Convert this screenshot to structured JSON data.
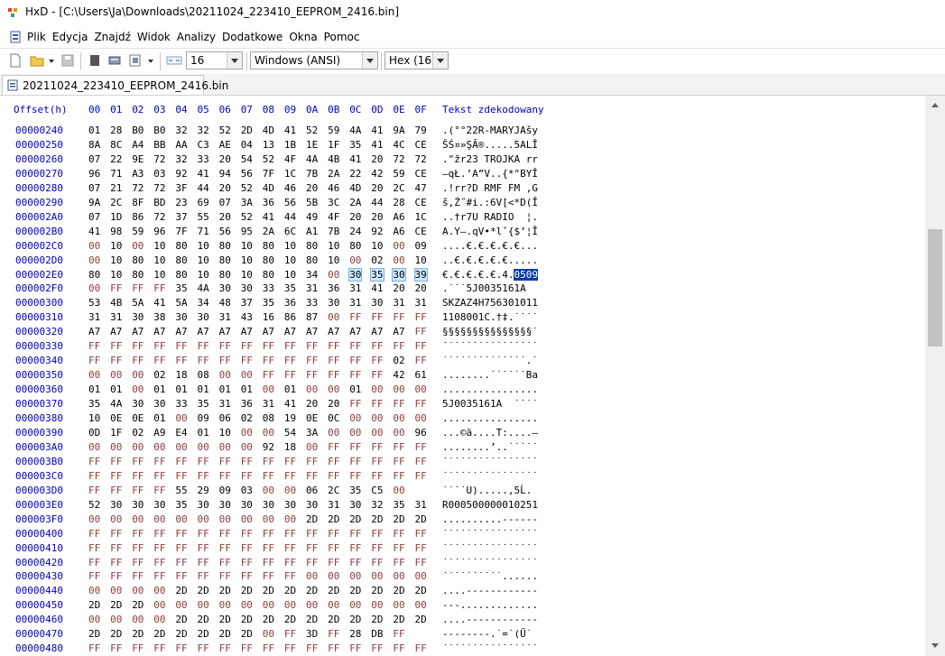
{
  "window": {
    "title": "HxD - [C:\\Users\\Ja\\Downloads\\20211024_223410_EEPROM_2416.bin]"
  },
  "menu": {
    "items": [
      "Plik",
      "Edycja",
      "Znajdź",
      "Widok",
      "Analizy",
      "Dodatkowe",
      "Okna",
      "Pomoc"
    ]
  },
  "toolbar": {
    "bytes_per_row": "16",
    "charset": "Windows (ANSI)",
    "number_base": "Hex (16)"
  },
  "tab": {
    "label": "20211024_223410_EEPROM_2416.bin"
  },
  "hex": {
    "offset_header": "Offset(h)",
    "column_headers": [
      "00",
      "01",
      "02",
      "03",
      "04",
      "05",
      "06",
      "07",
      "08",
      "09",
      "0A",
      "0B",
      "0C",
      "0D",
      "0E",
      "0F"
    ],
    "text_header": "Tekst zdekodowany",
    "rows": [
      {
        "offset": "00000240",
        "bytes": [
          "01",
          "28",
          "B0",
          "B0",
          "32",
          "32",
          "52",
          "2D",
          "4D",
          "41",
          "52",
          "59",
          "4A",
          "41",
          "9A",
          "79"
        ],
        "text": ".(°°22R-MARYJAšy"
      },
      {
        "offset": "00000250",
        "bytes": [
          "8A",
          "8C",
          "A4",
          "BB",
          "AA",
          "C3",
          "AE",
          "04",
          "13",
          "1B",
          "1E",
          "1F",
          "35",
          "41",
          "4C",
          "CE"
        ],
        "text": "ŠŚ¤»ŞĂ®.....5ALÎ"
      },
      {
        "offset": "00000260",
        "bytes": [
          "07",
          "22",
          "9E",
          "72",
          "32",
          "33",
          "20",
          "54",
          "52",
          "4F",
          "4A",
          "4B",
          "41",
          "20",
          "72",
          "72"
        ],
        "text": ".\"žr23 TROJKA rr"
      },
      {
        "offset": "00000270",
        "bytes": [
          "96",
          "71",
          "A3",
          "03",
          "92",
          "41",
          "94",
          "56",
          "7F",
          "1C",
          "7B",
          "2A",
          "22",
          "42",
          "59",
          "CE"
        ],
        "text": "–qŁ.’A”V..{*\"BYÎ"
      },
      {
        "offset": "00000280",
        "bytes": [
          "07",
          "21",
          "72",
          "72",
          "3F",
          "44",
          "20",
          "52",
          "4D",
          "46",
          "20",
          "46",
          "4D",
          "20",
          "2C",
          "47"
        ],
        "text": ".!rr?D RMF FM ,G"
      },
      {
        "offset": "00000290",
        "bytes": [
          "9A",
          "2C",
          "8F",
          "BD",
          "23",
          "69",
          "07",
          "3A",
          "36",
          "56",
          "5B",
          "3C",
          "2A",
          "44",
          "28",
          "CE"
        ],
        "text": "š,Ź˝#i.:6V[<*D(Î"
      },
      {
        "offset": "000002A0",
        "bytes": [
          "07",
          "1D",
          "86",
          "72",
          "37",
          "55",
          "20",
          "52",
          "41",
          "44",
          "49",
          "4F",
          "20",
          "20",
          "A6",
          "1C"
        ],
        "text": "..†r7U RADIO  ¦."
      },
      {
        "offset": "000002B0",
        "bytes": [
          "41",
          "98",
          "59",
          "96",
          "7F",
          "71",
          "56",
          "95",
          "2A",
          "6C",
          "A1",
          "7B",
          "24",
          "92",
          "A6",
          "CE"
        ],
        "text": "A.Y–.qV•*lˇ{$’¦Î"
      },
      {
        "offset": "000002C0",
        "bytes": [
          "00",
          "10",
          "00",
          "10",
          "80",
          "10",
          "80",
          "10",
          "80",
          "10",
          "80",
          "10",
          "80",
          "10",
          "00",
          "09"
        ],
        "text": "....€.€.€.€.€..."
      },
      {
        "offset": "000002D0",
        "bytes": [
          "00",
          "10",
          "80",
          "10",
          "80",
          "10",
          "80",
          "10",
          "80",
          "10",
          "80",
          "10",
          "00",
          "02",
          "00",
          "10"
        ],
        "text": "..€.€.€.€.€....."
      },
      {
        "offset": "000002E0",
        "bytes": [
          "80",
          "10",
          "80",
          "10",
          "80",
          "10",
          "80",
          "10",
          "80",
          "10",
          "34",
          "00",
          "30",
          "35",
          "30",
          "39"
        ],
        "text": "€.€.€.€.€.4.0509"
      },
      {
        "offset": "000002F0",
        "bytes": [
          "00",
          "FF",
          "FF",
          "FF",
          "35",
          "4A",
          "30",
          "30",
          "33",
          "35",
          "31",
          "36",
          "31",
          "41",
          "20",
          "20"
        ],
        "text": ".˙˙˙5J0035161A  "
      },
      {
        "offset": "00000300",
        "bytes": [
          "53",
          "4B",
          "5A",
          "41",
          "5A",
          "34",
          "48",
          "37",
          "35",
          "36",
          "33",
          "30",
          "31",
          "30",
          "31",
          "31"
        ],
        "text": "SKZAZ4H756301011"
      },
      {
        "offset": "00000310",
        "bytes": [
          "31",
          "31",
          "30",
          "38",
          "30",
          "30",
          "31",
          "43",
          "16",
          "86",
          "87",
          "00",
          "FF",
          "FF",
          "FF",
          "FF"
        ],
        "text": "1108001C.†‡.˙˙˙˙"
      },
      {
        "offset": "00000320",
        "bytes": [
          "A7",
          "A7",
          "A7",
          "A7",
          "A7",
          "A7",
          "A7",
          "A7",
          "A7",
          "A7",
          "A7",
          "A7",
          "A7",
          "A7",
          "A7",
          "FF"
        ],
        "text": "§§§§§§§§§§§§§§§˙"
      },
      {
        "offset": "00000330",
        "bytes": [
          "FF",
          "FF",
          "FF",
          "FF",
          "FF",
          "FF",
          "FF",
          "FF",
          "FF",
          "FF",
          "FF",
          "FF",
          "FF",
          "FF",
          "FF",
          "FF"
        ],
        "text": "˙˙˙˙˙˙˙˙˙˙˙˙˙˙˙˙"
      },
      {
        "offset": "00000340",
        "bytes": [
          "FF",
          "FF",
          "FF",
          "FF",
          "FF",
          "FF",
          "FF",
          "FF",
          "FF",
          "FF",
          "FF",
          "FF",
          "FF",
          "FF",
          "02",
          "FF"
        ],
        "text": "˙˙˙˙˙˙˙˙˙˙˙˙˙˙.˙"
      },
      {
        "offset": "00000350",
        "bytes": [
          "00",
          "00",
          "00",
          "02",
          "18",
          "08",
          "00",
          "00",
          "FF",
          "FF",
          "FF",
          "FF",
          "FF",
          "FF",
          "42",
          "61"
        ],
        "text": "........˙˙˙˙˙˙Ba"
      },
      {
        "offset": "00000360",
        "bytes": [
          "01",
          "01",
          "00",
          "01",
          "01",
          "01",
          "01",
          "01",
          "00",
          "01",
          "00",
          "00",
          "01",
          "00",
          "00",
          "00"
        ],
        "text": "................"
      },
      {
        "offset": "00000370",
        "bytes": [
          "35",
          "4A",
          "30",
          "30",
          "33",
          "35",
          "31",
          "36",
          "31",
          "41",
          "20",
          "20",
          "FF",
          "FF",
          "FF",
          "FF"
        ],
        "text": "5J0035161A  ˙˙˙˙"
      },
      {
        "offset": "00000380",
        "bytes": [
          "10",
          "0E",
          "0E",
          "01",
          "00",
          "09",
          "06",
          "02",
          "08",
          "19",
          "0E",
          "0C",
          "00",
          "00",
          "00",
          "00"
        ],
        "text": "................"
      },
      {
        "offset": "00000390",
        "bytes": [
          "0D",
          "1F",
          "02",
          "A9",
          "E4",
          "01",
          "10",
          "00",
          "00",
          "54",
          "3A",
          "00",
          "00",
          "00",
          "00",
          "96"
        ],
        "text": "...©ä....T:....–"
      },
      {
        "offset": "000003A0",
        "bytes": [
          "00",
          "00",
          "00",
          "00",
          "00",
          "00",
          "00",
          "00",
          "92",
          "18",
          "00",
          "FF",
          "FF",
          "FF",
          "FF",
          "FF"
        ],
        "text": "........’..˙˙˙˙˙"
      },
      {
        "offset": "000003B0",
        "bytes": [
          "FF",
          "FF",
          "FF",
          "FF",
          "FF",
          "FF",
          "FF",
          "FF",
          "FF",
          "FF",
          "FF",
          "FF",
          "FF",
          "FF",
          "FF",
          "FF"
        ],
        "text": "˙˙˙˙˙˙˙˙˙˙˙˙˙˙˙˙"
      },
      {
        "offset": "000003C0",
        "bytes": [
          "FF",
          "FF",
          "FF",
          "FF",
          "FF",
          "FF",
          "FF",
          "FF",
          "FF",
          "FF",
          "FF",
          "FF",
          "FF",
          "FF",
          "FF",
          "FF"
        ],
        "text": "˙˙˙˙˙˙˙˙˙˙˙˙˙˙˙˙"
      },
      {
        "offset": "000003D0",
        "bytes": [
          "FF",
          "FF",
          "FF",
          "FF",
          "55",
          "29",
          "09",
          "03",
          "00",
          "00",
          "06",
          "2C",
          "35",
          "C5",
          "00"
        ],
        "text": "˙˙˙˙U).....,5Ĺ."
      },
      {
        "offset": "000003E0",
        "bytes": [
          "52",
          "30",
          "30",
          "30",
          "35",
          "30",
          "30",
          "30",
          "30",
          "30",
          "30",
          "31",
          "30",
          "32",
          "35",
          "31"
        ],
        "text": "R000500000010251"
      },
      {
        "offset": "000003F0",
        "bytes": [
          "00",
          "00",
          "00",
          "00",
          "00",
          "00",
          "00",
          "00",
          "00",
          "00",
          "2D",
          "2D",
          "2D",
          "2D",
          "2D",
          "2D"
        ],
        "text": "..........------"
      },
      {
        "offset": "00000400",
        "bytes": [
          "FF",
          "FF",
          "FF",
          "FF",
          "FF",
          "FF",
          "FF",
          "FF",
          "FF",
          "FF",
          "FF",
          "FF",
          "FF",
          "FF",
          "FF",
          "FF"
        ],
        "text": "˙˙˙˙˙˙˙˙˙˙˙˙˙˙˙˙"
      },
      {
        "offset": "00000410",
        "bytes": [
          "FF",
          "FF",
          "FF",
          "FF",
          "FF",
          "FF",
          "FF",
          "FF",
          "FF",
          "FF",
          "FF",
          "FF",
          "FF",
          "FF",
          "FF",
          "FF"
        ],
        "text": "˙˙˙˙˙˙˙˙˙˙˙˙˙˙˙˙"
      },
      {
        "offset": "00000420",
        "bytes": [
          "FF",
          "FF",
          "FF",
          "FF",
          "FF",
          "FF",
          "FF",
          "FF",
          "FF",
          "FF",
          "FF",
          "FF",
          "FF",
          "FF",
          "FF",
          "FF"
        ],
        "text": "˙˙˙˙˙˙˙˙˙˙˙˙˙˙˙˙"
      },
      {
        "offset": "00000430",
        "bytes": [
          "FF",
          "FF",
          "FF",
          "FF",
          "FF",
          "FF",
          "FF",
          "FF",
          "FF",
          "FF",
          "00",
          "00",
          "00",
          "00",
          "00",
          "00"
        ],
        "text": "˙˙˙˙˙˙˙˙˙˙......"
      },
      {
        "offset": "00000440",
        "bytes": [
          "00",
          "00",
          "00",
          "00",
          "2D",
          "2D",
          "2D",
          "2D",
          "2D",
          "2D",
          "2D",
          "2D",
          "2D",
          "2D",
          "2D",
          "2D"
        ],
        "text": "....------------"
      },
      {
        "offset": "00000450",
        "bytes": [
          "2D",
          "2D",
          "2D",
          "00",
          "00",
          "00",
          "00",
          "00",
          "00",
          "00",
          "00",
          "00",
          "00",
          "00",
          "00",
          "00"
        ],
        "text": "---............."
      },
      {
        "offset": "00000460",
        "bytes": [
          "00",
          "00",
          "00",
          "00",
          "2D",
          "2D",
          "2D",
          "2D",
          "2D",
          "2D",
          "2D",
          "2D",
          "2D",
          "2D",
          "2D",
          "2D"
        ],
        "text": "....------------"
      },
      {
        "offset": "00000470",
        "bytes": [
          "2D",
          "2D",
          "2D",
          "2D",
          "2D",
          "2D",
          "2D",
          "2D",
          "00",
          "FF",
          "3D",
          "FF",
          "28",
          "DB",
          "FF"
        ],
        "text": "--------.˙=˙(Ű˙"
      },
      {
        "offset": "00000480",
        "bytes": [
          "FF",
          "FF",
          "FF",
          "FF",
          "FF",
          "FF",
          "FF",
          "FF",
          "FF",
          "FF",
          "FF",
          "FF",
          "FF",
          "FF",
          "FF",
          "FF"
        ],
        "text": "˙˙˙˙˙˙˙˙˙˙˙˙˙˙˙˙"
      }
    ]
  },
  "selection": {
    "offset": "000002EC",
    "length": 4
  },
  "colors": {
    "offset": "#0000c0",
    "byte_light": "#8c3e3e",
    "selection": "#cce8ff",
    "caret": "#0a3ea6"
  }
}
